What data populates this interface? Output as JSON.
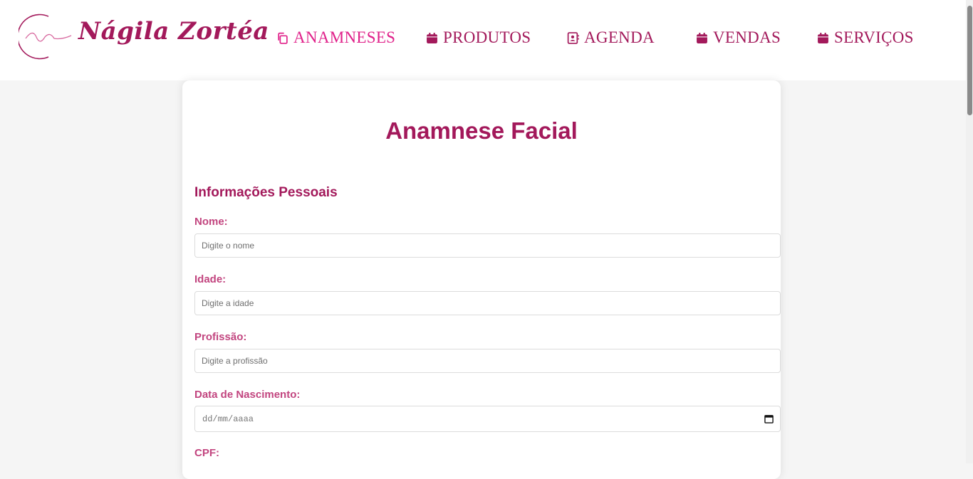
{
  "brand": {
    "logo_text": "Nágila Zortéa"
  },
  "nav": [
    {
      "label": "ANAMNESES",
      "icon": "copy-icon",
      "active": true
    },
    {
      "label": "PRODUTOS",
      "icon": "calendar-icon"
    },
    {
      "label": "AGENDA",
      "icon": "contact-book-icon"
    },
    {
      "label": "VENDAS",
      "icon": "calendar-icon"
    },
    {
      "label": "SERVIÇOS",
      "icon": "calendar-icon"
    }
  ],
  "form": {
    "title": "Anamnese Facial",
    "section_title": "Informações Pessoais",
    "fields": {
      "nome": {
        "label": "Nome:",
        "placeholder": "Digite o nome"
      },
      "idade": {
        "label": "Idade:",
        "placeholder": "Digite a idade"
      },
      "profissao": {
        "label": "Profissão:",
        "placeholder": "Digite a profissão"
      },
      "nascimento": {
        "label": "Data de Nascimento:",
        "placeholder": "dd/mm/aaaa"
      },
      "cpf": {
        "label": "CPF:"
      }
    }
  },
  "colors": {
    "brand": "#a3195b",
    "active": "#e0218a",
    "label": "#c2457f"
  }
}
